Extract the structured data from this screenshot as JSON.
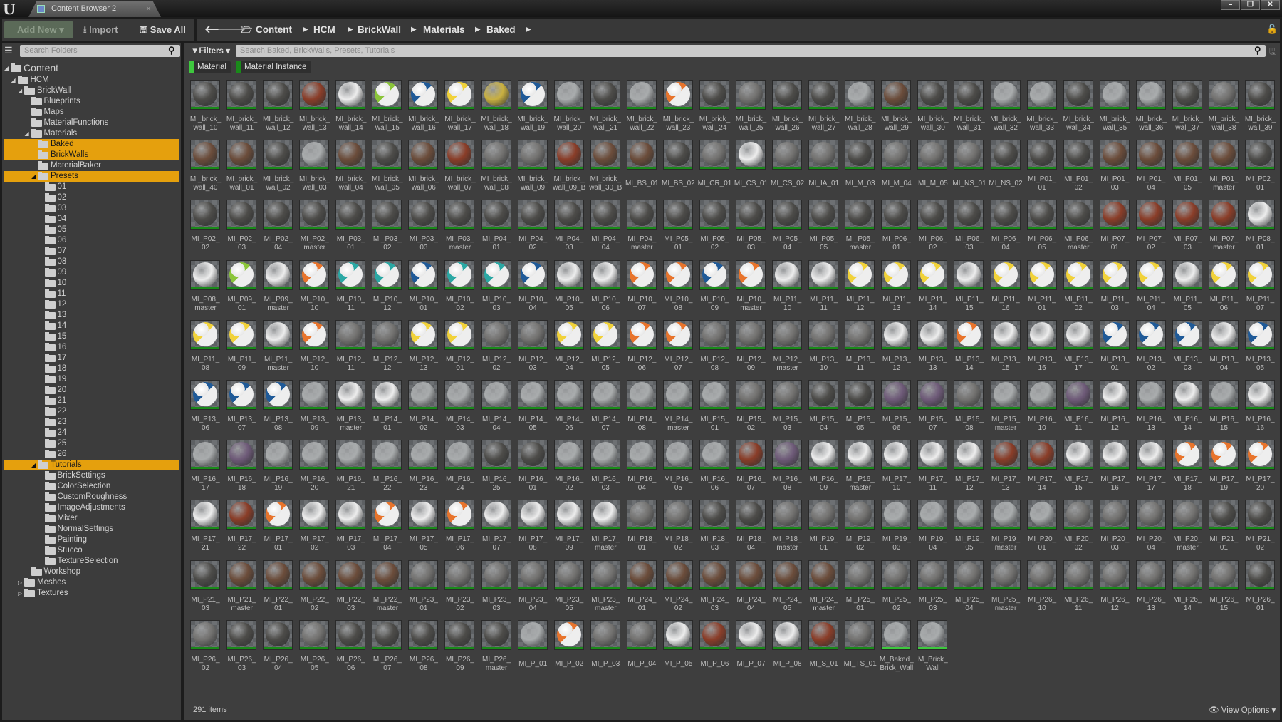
{
  "window": {
    "tab_title": "Content Browser 2",
    "logo": "U",
    "controls": [
      "minimize",
      "restore",
      "close"
    ]
  },
  "toolbar": {
    "add_new": "Add New",
    "import": "Import",
    "save_all": "Save All"
  },
  "breadcrumb": [
    "Content",
    "HCM",
    "BrickWall",
    "Materials",
    "Baked"
  ],
  "folders": {
    "search_placeholder": "Search Folders",
    "tree": [
      {
        "label": "Content",
        "depth": 0,
        "expanded": true
      },
      {
        "label": "HCM",
        "depth": 1,
        "expanded": true
      },
      {
        "label": "BrickWall",
        "depth": 2,
        "expanded": true
      },
      {
        "label": "Blueprints",
        "depth": 3
      },
      {
        "label": "Maps",
        "depth": 3
      },
      {
        "label": "MaterialFunctions",
        "depth": 3
      },
      {
        "label": "Materials",
        "depth": 3,
        "expanded": true
      },
      {
        "label": "Baked",
        "depth": 4,
        "selected": true
      },
      {
        "label": "BrickWalls",
        "depth": 4,
        "selected": true
      },
      {
        "label": "MaterialBaker",
        "depth": 4
      },
      {
        "label": "Presets",
        "depth": 4,
        "expanded": true,
        "selected": true
      },
      {
        "label": "01",
        "depth": 5
      },
      {
        "label": "02",
        "depth": 5
      },
      {
        "label": "03",
        "depth": 5
      },
      {
        "label": "04",
        "depth": 5
      },
      {
        "label": "05",
        "depth": 5
      },
      {
        "label": "06",
        "depth": 5
      },
      {
        "label": "07",
        "depth": 5
      },
      {
        "label": "08",
        "depth": 5
      },
      {
        "label": "09",
        "depth": 5
      },
      {
        "label": "10",
        "depth": 5
      },
      {
        "label": "11",
        "depth": 5
      },
      {
        "label": "12",
        "depth": 5
      },
      {
        "label": "13",
        "depth": 5
      },
      {
        "label": "14",
        "depth": 5
      },
      {
        "label": "15",
        "depth": 5
      },
      {
        "label": "16",
        "depth": 5
      },
      {
        "label": "17",
        "depth": 5
      },
      {
        "label": "18",
        "depth": 5
      },
      {
        "label": "19",
        "depth": 5
      },
      {
        "label": "20",
        "depth": 5
      },
      {
        "label": "21",
        "depth": 5
      },
      {
        "label": "22",
        "depth": 5
      },
      {
        "label": "23",
        "depth": 5
      },
      {
        "label": "24",
        "depth": 5
      },
      {
        "label": "25",
        "depth": 5
      },
      {
        "label": "26",
        "depth": 5
      },
      {
        "label": "Tutorials",
        "depth": 4,
        "expanded": true,
        "selected": true
      },
      {
        "label": "BrickSettings",
        "depth": 5
      },
      {
        "label": "ColorSelection",
        "depth": 5
      },
      {
        "label": "CustomRoughness",
        "depth": 5
      },
      {
        "label": "ImageAdjustments",
        "depth": 5
      },
      {
        "label": "Mixer",
        "depth": 5
      },
      {
        "label": "NormalSettings",
        "depth": 5
      },
      {
        "label": "Painting",
        "depth": 5
      },
      {
        "label": "Stucco",
        "depth": 5
      },
      {
        "label": "TextureSelection",
        "depth": 5
      },
      {
        "label": "Workshop",
        "depth": 3
      },
      {
        "label": "Meshes",
        "depth": 2,
        "expanded": false
      },
      {
        "label": "Textures",
        "depth": 2,
        "expanded": false
      }
    ]
  },
  "assets": {
    "filters_label": "Filters",
    "search_placeholder": "Search Baked, BrickWalls, Presets, Tutorials",
    "filter_chips": [
      {
        "label": "Material",
        "color": "#3ec83e"
      },
      {
        "label": "Material Instance",
        "color": "#1a8a1a"
      }
    ],
    "status": "291 items",
    "view_options": "View Options",
    "tone_colors": {
      "d": "#4c4b48",
      "g": "#737270",
      "l": "#a9acad",
      "w": "#ededed",
      "b": "#6b4c3a",
      "r": "#8a3d28",
      "G": "#8bc53a",
      "u": "#1f5a98",
      "y": "#f1d23a",
      "Y": "#c9b040",
      "o": "#e8742c",
      "t": "#2aa8a4",
      "p": "#6e5a78"
    },
    "tones": [
      "dddrwGuyYuldlodgddlbddlldlldgd",
      "bbdlbdbrggrbbdgwggdgggdddbbbbd",
      "dddddddddddddddddddddddddrrrrw",
      "wGwottuttuwwoouowwyyywyyyyywyy",
      "yywoggyyggyyoogggggwwowwwuuuwu",
      "uuulwwlllllllllggddppgllpwlwlw",
      "lpllllllddlllllrpwwwwwrrwwwooo",
      "wrowwowowwwwggddggglllllggggdd",
      "dbbbbbggggggbbbbbbgggggggggggd",
      "gddgdddddloggwrwwrgll"
    ],
    "items": [
      "MI_brick_wall_10",
      "MI_brick_wall_11",
      "MI_brick_wall_12",
      "MI_brick_wall_13",
      "MI_brick_wall_14",
      "MI_brick_wall_15",
      "MI_brick_wall_16",
      "MI_brick_wall_17",
      "MI_brick_wall_18",
      "MI_brick_wall_19",
      "MI_brick_wall_20",
      "MI_brick_wall_21",
      "MI_brick_wall_22",
      "MI_brick_wall_23",
      "MI_brick_wall_24",
      "MI_brick_wall_25",
      "MI_brick_wall_26",
      "MI_brick_wall_27",
      "MI_brick_wall_28",
      "MI_brick_wall_29",
      "MI_brick_wall_30",
      "MI_brick_wall_31",
      "MI_brick_wall_32",
      "MI_brick_wall_33",
      "MI_brick_wall_34",
      "MI_brick_wall_35",
      "MI_brick_wall_36",
      "MI_brick_wall_37",
      "MI_brick_wall_38",
      "MI_brick_wall_39",
      "MI_brick_wall_40",
      "MI_brick_wall_01",
      "MI_brick_wall_02",
      "MI_brick_wall_03",
      "MI_brick_wall_04",
      "MI_brick_wall_05",
      "MI_brick_wall_06",
      "MI_brick_wall_07",
      "MI_brick_wall_08",
      "MI_brick_wall_09",
      "MI_brick_wall_09_B",
      "MI_brick_wall_30_B",
      "MI_BS_01",
      "MI_BS_02",
      "MI_CR_01",
      "MI_CS_01",
      "MI_CS_02",
      "MI_IA_01",
      "MI_M_03",
      "MI_M_04",
      "MI_M_05",
      "MI_NS_01",
      "MI_NS_02",
      "MI_P01_01",
      "MI_P01_02",
      "MI_P01_03",
      "MI_P01_04",
      "MI_P01_05",
      "MI_P01_master",
      "MI_P02_01",
      "MI_P02_02",
      "MI_P02_03",
      "MI_P02_04",
      "MI_P02_master",
      "MI_P03_01",
      "MI_P03_02",
      "MI_P03_03",
      "MI_P03_master",
      "MI_P04_01",
      "MI_P04_02",
      "MI_P04_03",
      "MI_P04_04",
      "MI_P04_master",
      "MI_P05_01",
      "MI_P05_02",
      "MI_P05_03",
      "MI_P05_04",
      "MI_P05_05",
      "MI_P05_master",
      "MI_P06_01",
      "MI_P06_02",
      "MI_P06_03",
      "MI_P06_04",
      "MI_P06_05",
      "MI_P06_master",
      "MI_P07_01",
      "MI_P07_02",
      "MI_P07_03",
      "MI_P07_master",
      "MI_P08_01",
      "MI_P08_master",
      "MI_P09_01",
      "MI_P09_master",
      "MI_P10_10",
      "MI_P10_11",
      "MI_P10_12",
      "MI_P10_01",
      "MI_P10_02",
      "MI_P10_03",
      "MI_P10_04",
      "MI_P10_05",
      "MI_P10_06",
      "MI_P10_07",
      "MI_P10_08",
      "MI_P10_09",
      "MI_P10_master",
      "MI_P11_10",
      "MI_P11_11",
      "MI_P11_12",
      "MI_P11_13",
      "MI_P11_14",
      "MI_P11_15",
      "MI_P11_16",
      "MI_P11_01",
      "MI_P11_02",
      "MI_P11_03",
      "MI_P11_04",
      "MI_P11_05",
      "MI_P11_06",
      "MI_P11_07",
      "MI_P11_08",
      "MI_P11_09",
      "MI_P11_master",
      "MI_P12_10",
      "MI_P12_11",
      "MI_P12_12",
      "MI_P12_13",
      "MI_P12_01",
      "MI_P12_02",
      "MI_P12_03",
      "MI_P12_04",
      "MI_P12_05",
      "MI_P12_06",
      "MI_P12_07",
      "MI_P12_08",
      "MI_P12_09",
      "MI_P12_master",
      "MI_P13_10",
      "MI_P13_11",
      "MI_P13_12",
      "MI_P13_13",
      "MI_P13_14",
      "MI_P13_15",
      "MI_P13_16",
      "MI_P13_17",
      "MI_P13_01",
      "MI_P13_02",
      "MI_P13_03",
      "MI_P13_04",
      "MI_P13_05",
      "MI_P13_06",
      "MI_P13_07",
      "MI_P13_08",
      "MI_P13_09",
      "MI_P13_master",
      "MI_P14_01",
      "MI_P14_02",
      "MI_P14_03",
      "MI_P14_04",
      "MI_P14_05",
      "MI_P14_06",
      "MI_P14_07",
      "MI_P14_08",
      "MI_P14_master",
      "MI_P15_01",
      "MI_P15_02",
      "MI_P15_03",
      "MI_P15_04",
      "MI_P15_05",
      "MI_P15_06",
      "MI_P15_07",
      "MI_P15_08",
      "MI_P15_master",
      "MI_P16_10",
      "MI_P16_11",
      "MI_P16_12",
      "MI_P16_13",
      "MI_P16_14",
      "MI_P16_15",
      "MI_P16_16",
      "MI_P16_17",
      "MI_P16_18",
      "MI_P16_19",
      "MI_P16_20",
      "MI_P16_21",
      "MI_P16_22",
      "MI_P16_23",
      "MI_P16_24",
      "MI_P16_25",
      "MI_P16_01",
      "MI_P16_02",
      "MI_P16_03",
      "MI_P16_04",
      "MI_P16_05",
      "MI_P16_06",
      "MI_P16_07",
      "MI_P16_08",
      "MI_P16_09",
      "MI_P16_master",
      "MI_P17_10",
      "MI_P17_11",
      "MI_P17_12",
      "MI_P17_13",
      "MI_P17_14",
      "MI_P17_15",
      "MI_P17_16",
      "MI_P17_17",
      "MI_P17_18",
      "MI_P17_19",
      "MI_P17_20",
      "MI_P17_21",
      "MI_P17_22",
      "MI_P17_01",
      "MI_P17_02",
      "MI_P17_03",
      "MI_P17_04",
      "MI_P17_05",
      "MI_P17_06",
      "MI_P17_07",
      "MI_P17_08",
      "MI_P17_09",
      "MI_P17_master",
      "MI_P18_01",
      "MI_P18_02",
      "MI_P18_03",
      "MI_P18_04",
      "MI_P18_master",
      "MI_P19_01",
      "MI_P19_02",
      "MI_P19_03",
      "MI_P19_04",
      "MI_P19_05",
      "MI_P19_master",
      "MI_P20_01",
      "MI_P20_02",
      "MI_P20_03",
      "MI_P20_04",
      "MI_P20_master",
      "MI_P21_01",
      "MI_P21_02",
      "MI_P21_03",
      "MI_P21_master",
      "MI_P22_01",
      "MI_P22_02",
      "MI_P22_03",
      "MI_P22_master",
      "MI_P23_01",
      "MI_P23_02",
      "MI_P23_03",
      "MI_P23_04",
      "MI_P23_05",
      "MI_P23_master",
      "MI_P24_01",
      "MI_P24_02",
      "MI_P24_03",
      "MI_P24_04",
      "MI_P24_05",
      "MI_P24_master",
      "MI_P25_01",
      "MI_P25_02",
      "MI_P25_03",
      "MI_P25_04",
      "MI_P25_master",
      "MI_P26_10",
      "MI_P26_11",
      "MI_P26_12",
      "MI_P26_13",
      "MI_P26_14",
      "MI_P26_15",
      "MI_P26_01",
      "MI_P26_02",
      "MI_P26_03",
      "MI_P26_04",
      "MI_P26_05",
      "MI_P26_06",
      "MI_P26_07",
      "MI_P26_08",
      "MI_P26_09",
      "MI_P26_master",
      "MI_P_01",
      "MI_P_02",
      "MI_P_03",
      "MI_P_04",
      "MI_P_05",
      "MI_P_06",
      "MI_P_07",
      "MI_P_08",
      "MI_S_01",
      "MI_TS_01",
      "M_Baked_Brick_Wall",
      "M_Brick_Wall"
    ]
  }
}
